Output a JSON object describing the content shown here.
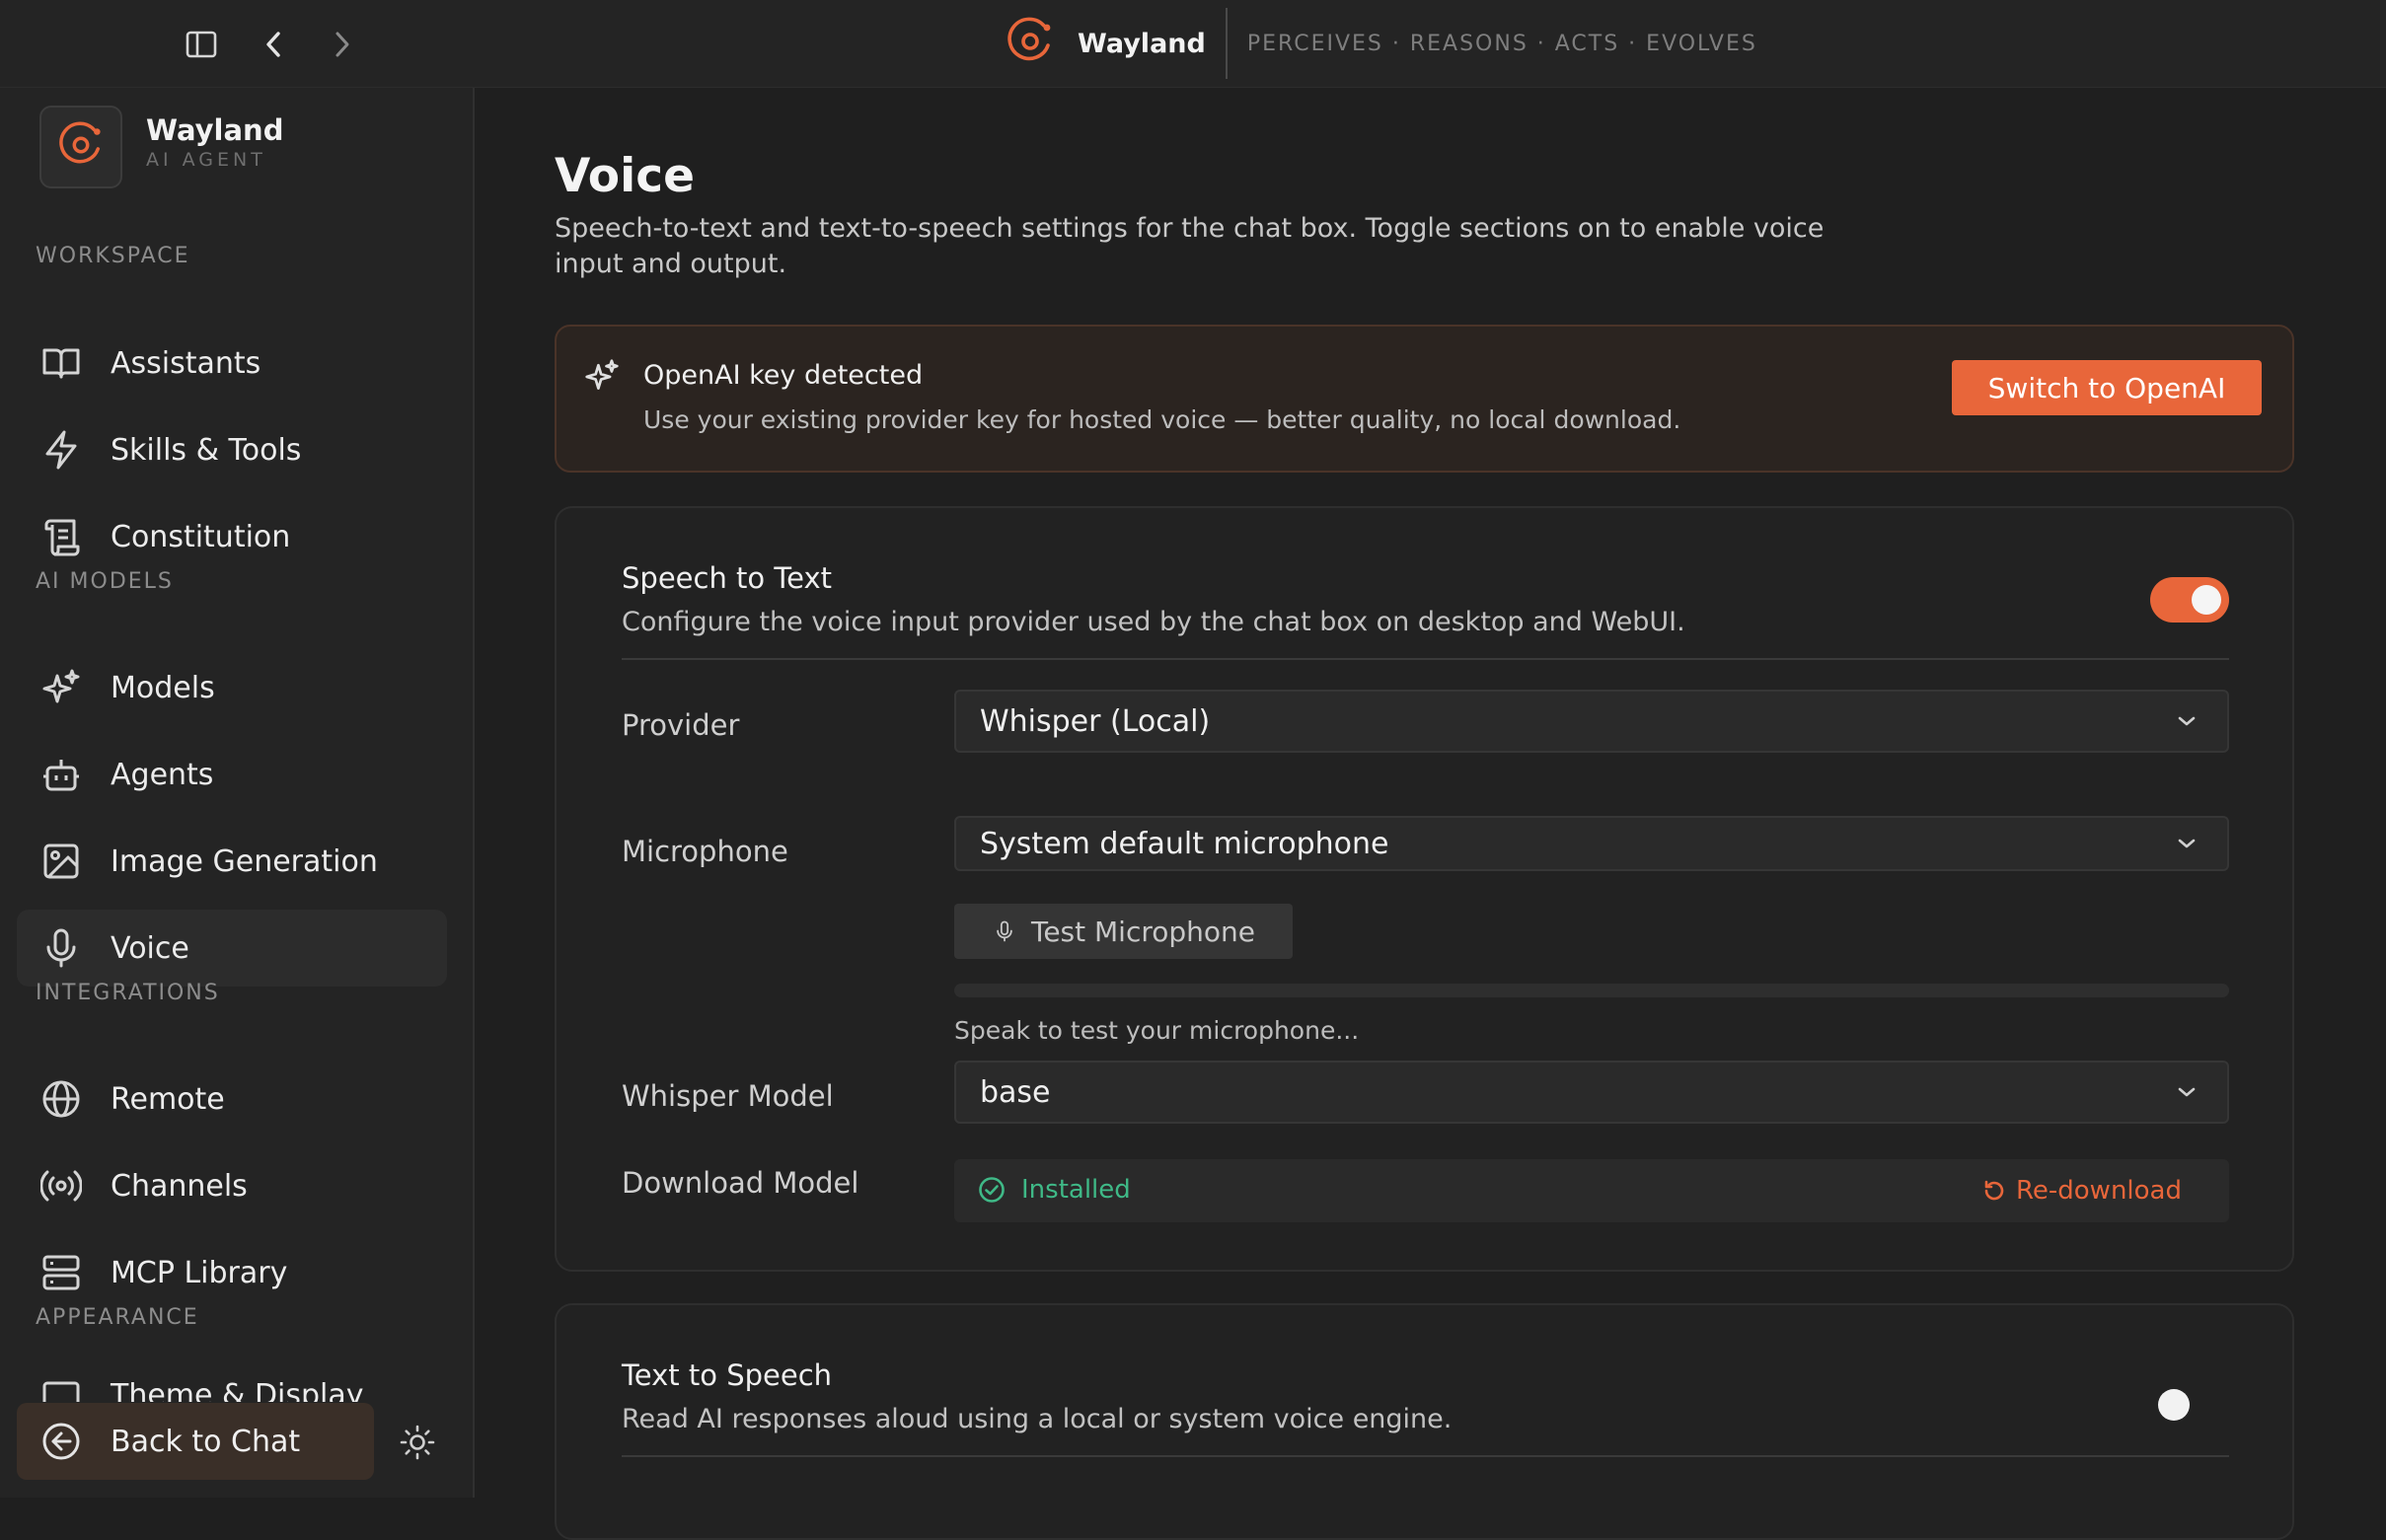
{
  "app": {
    "name": "Wayland",
    "tagline": "PERCEIVES · REASONS · ACTS · EVOLVES",
    "accent": "#e8663a"
  },
  "sidebar": {
    "brand_name": "Wayland",
    "brand_sub": "AI AGENT",
    "sections": {
      "workspace": "WORKSPACE",
      "ai_models": "AI MODELS",
      "integrations": "INTEGRATIONS",
      "appearance": "APPEARANCE"
    },
    "items": [
      {
        "label": "Assistants",
        "icon": "book-icon"
      },
      {
        "label": "Skills & Tools",
        "icon": "bolt-icon"
      },
      {
        "label": "Constitution",
        "icon": "scroll-icon"
      },
      {
        "label": "Models",
        "icon": "sparkles-icon"
      },
      {
        "label": "Agents",
        "icon": "bot-icon"
      },
      {
        "label": "Image Generation",
        "icon": "image-icon"
      },
      {
        "label": "Voice",
        "icon": "microphone-icon",
        "active": true
      },
      {
        "label": "Remote",
        "icon": "globe-icon"
      },
      {
        "label": "Channels",
        "icon": "broadcast-icon"
      },
      {
        "label": "MCP Library",
        "icon": "server-icon"
      },
      {
        "label": "Theme & Display",
        "icon": "monitor-icon"
      }
    ],
    "back_label": "Back to Chat"
  },
  "page": {
    "title": "Voice",
    "description": "Speech-to-text and text-to-speech settings for the chat box. Toggle sections on to enable voice input and output."
  },
  "notice": {
    "title": "OpenAI key detected",
    "description": "Use your existing provider key for hosted voice — better quality, no local download.",
    "button": "Switch to OpenAI"
  },
  "stt": {
    "title": "Speech to Text",
    "description": "Configure the voice input provider used by the chat box on desktop and WebUI.",
    "enabled": true,
    "provider_label": "Provider",
    "provider_value": "Whisper (Local)",
    "microphone_label": "Microphone",
    "microphone_value": "System default microphone",
    "test_button": "Test Microphone",
    "mic_level": 0,
    "hint": "Speak to test your microphone...",
    "whisper_label": "Whisper Model",
    "whisper_value": "base",
    "download_label": "Download Model",
    "installed": "Installed",
    "redownload": "Re-download"
  },
  "tts": {
    "title": "Text to Speech",
    "description": "Read AI responses aloud using a local or system voice engine.",
    "enabled": false
  }
}
